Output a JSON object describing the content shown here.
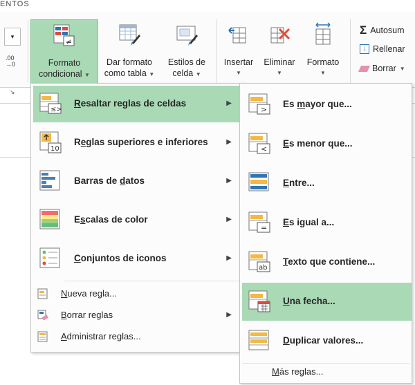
{
  "ribbon": {
    "tab_hint": "ENTOS",
    "buttons": {
      "cond_format": {
        "line1": "Formato",
        "line2": "condicional"
      },
      "format_table": {
        "line1": "Dar formato",
        "line2": "como tabla"
      },
      "cell_styles": {
        "line1": "Estilos de",
        "line2": "celda"
      },
      "insert": {
        "line1": "Insertar"
      },
      "delete": {
        "line1": "Eliminar"
      },
      "format": {
        "line1": "Formato"
      }
    },
    "editing": {
      "autosum": "Autosum",
      "fill": "Rellenar",
      "clear": "Borrar"
    }
  },
  "menu": {
    "items": [
      {
        "pre": "",
        "u": "R",
        "post": "esaltar reglas de celdas",
        "icon": "highlight-cells-rules-icon"
      },
      {
        "pre": "R",
        "u": "e",
        "post": "glas superiores e inferiores",
        "icon": "top-bottom-rules-icon"
      },
      {
        "pre": "Barras de ",
        "u": "d",
        "post": "atos",
        "icon": "data-bars-icon"
      },
      {
        "pre": "E",
        "u": "s",
        "post": "calas de color",
        "icon": "color-scales-icon"
      },
      {
        "pre": "",
        "u": "C",
        "post": "onjuntos de iconos",
        "icon": "icon-sets-icon"
      }
    ],
    "small_items": [
      {
        "pre": "",
        "u": "N",
        "post": "ueva regla...",
        "icon": "new-rule-icon"
      },
      {
        "pre": "",
        "u": "B",
        "post": "orrar reglas",
        "icon": "clear-rules-icon"
      },
      {
        "pre": "",
        "u": "A",
        "post": "dministrar reglas...",
        "icon": "manage-rules-icon"
      }
    ]
  },
  "submenu": {
    "items": [
      {
        "pre": "Es ",
        "u": "m",
        "post": "ayor que...",
        "icon": "greater-than-icon"
      },
      {
        "pre": "",
        "u": "E",
        "post": "s menor que...",
        "icon": "less-than-icon"
      },
      {
        "pre": "",
        "u": "E",
        "post": "ntre...",
        "icon": "between-icon"
      },
      {
        "pre": "",
        "u": "E",
        "post": "s igual a...",
        "icon": "equal-to-icon"
      },
      {
        "pre": "",
        "u": "T",
        "post": "exto que contiene...",
        "icon": "text-contains-icon"
      },
      {
        "pre": "",
        "u": "U",
        "post": "na fecha...",
        "icon": "date-occurring-icon"
      },
      {
        "pre": "",
        "u": "D",
        "post": "uplicar valores...",
        "icon": "duplicate-values-icon"
      }
    ],
    "more_rules": {
      "pre": "",
      "u": "M",
      "post": "ás reglas..."
    }
  }
}
